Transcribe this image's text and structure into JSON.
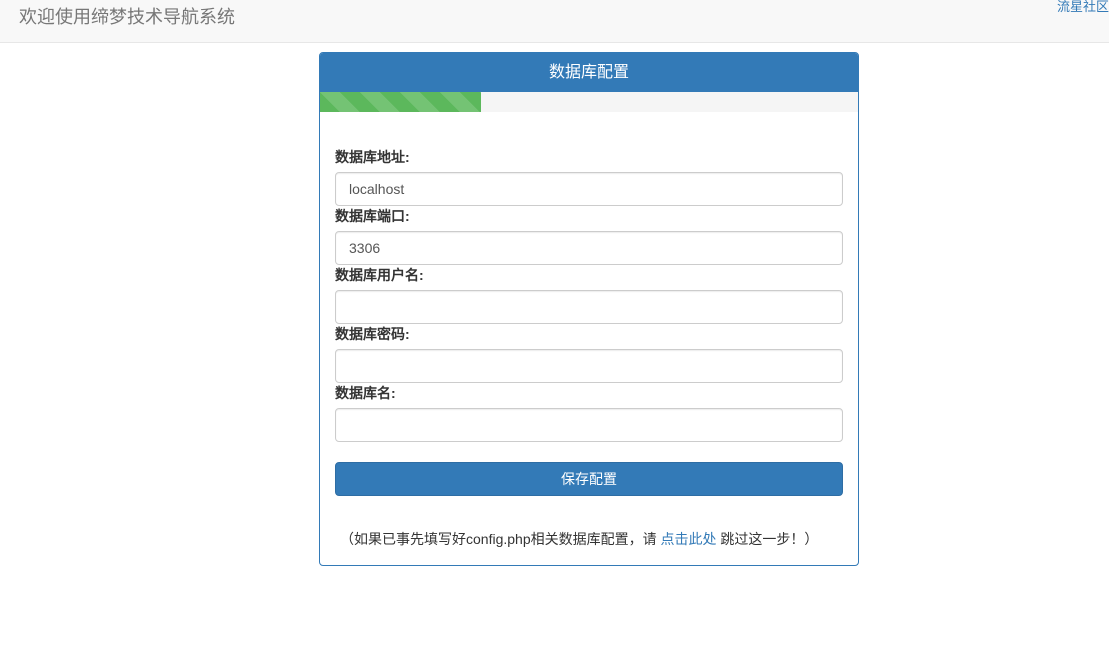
{
  "navbar": {
    "brand": "欢迎使用缔梦技术导航系统",
    "link": "流星社区"
  },
  "panel": {
    "title": "数据库配置",
    "progress_percent": 30,
    "progress_color": "#5cb85c",
    "accent_color": "#337ab7"
  },
  "form": {
    "host": {
      "label": "数据库地址:",
      "value": "localhost"
    },
    "port": {
      "label": "数据库端口:",
      "value": "3306"
    },
    "user": {
      "label": "数据库用户名:",
      "value": ""
    },
    "password": {
      "label": "数据库密码:",
      "value": ""
    },
    "dbname": {
      "label": "数据库名:",
      "value": ""
    },
    "save_label": "保存配置"
  },
  "footnote": {
    "prefix": "（如果已事先填写好config.php相关数据库配置，请 ",
    "link": "点击此处",
    "suffix": " 跳过这一步！）"
  }
}
